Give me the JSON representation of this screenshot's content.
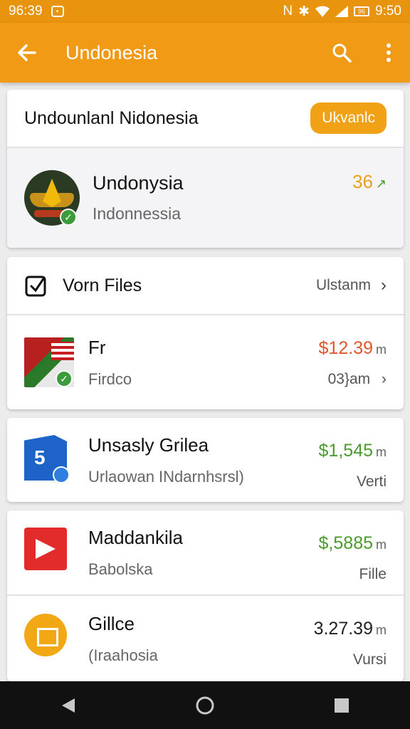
{
  "status_bar": {
    "time_left": "96:39",
    "battery": "96",
    "time_right": "9:50"
  },
  "app_bar": {
    "title": "Undonesia"
  },
  "country_card": {
    "heading": "Undounlanl Nidonesia",
    "action_label": "Ukvanlc",
    "item": {
      "title": "Undonysia",
      "subtitle": "Indonnessia",
      "value": "36"
    }
  },
  "files_card": {
    "section_label": "Vorn Files",
    "section_link": "Ulstanm",
    "item": {
      "name": "Fr",
      "sub": "Firdco",
      "amount": "$12.39",
      "unit": "m",
      "meta": "03}am"
    }
  },
  "list": [
    {
      "name": "Unsasly Grilea",
      "sub": "Urlaowan INdarnhsrsl)",
      "amount": "$1,545",
      "unit": "m",
      "meta": "Verti"
    },
    {
      "name": "Maddankila",
      "sub": "Babolska",
      "amount": "$,5885",
      "unit": "m",
      "meta": "Fille"
    },
    {
      "name": "Gillce",
      "sub": "(Iraahosia",
      "amount": "3.27.39",
      "unit": "m",
      "meta": "Vursi"
    }
  ],
  "colors": {
    "accent": "#f09a16",
    "positive": "#4a9c2a",
    "negative": "#e0582a"
  },
  "icons": [
    "back-arrow-icon",
    "search-icon",
    "more-vert-icon",
    "checkbox-icon",
    "chevron-right-icon",
    "trending-up-icon",
    "back-nav-icon",
    "home-nav-icon",
    "recents-nav-icon"
  ]
}
